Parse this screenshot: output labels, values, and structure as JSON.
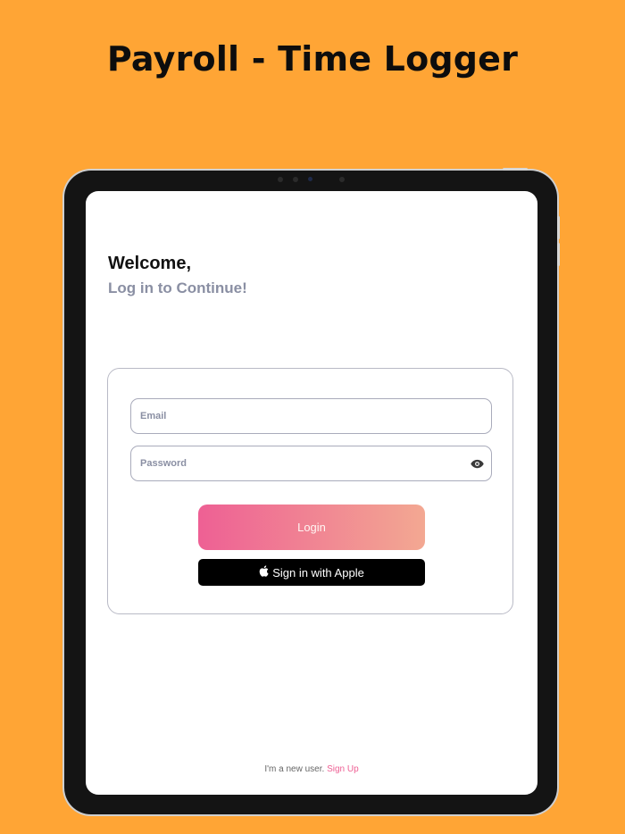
{
  "banner": {
    "title": "Payroll - Time Logger"
  },
  "screen": {
    "welcome": "Welcome,",
    "subtitle": "Log in to Continue!"
  },
  "form": {
    "email_placeholder": "Email",
    "password_placeholder": "Password",
    "login_label": "Login",
    "apple_label": "Sign in with Apple"
  },
  "footer": {
    "prefix": "I'm a new user. ",
    "signup_label": "Sign Up"
  },
  "icons": {
    "password_toggle": "eye-icon",
    "apple": "apple-logo-icon"
  },
  "colors": {
    "background": "#FFA535",
    "accent": "#EE6094",
    "gradient_end": "#F3A892",
    "muted_text": "#8A8FA3"
  }
}
